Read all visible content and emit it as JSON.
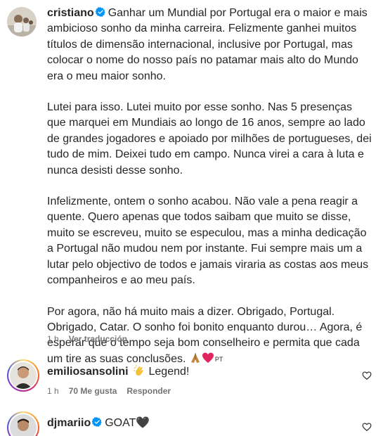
{
  "post": {
    "username": "cristiano",
    "paragraphs": [
      "Ganhar um Mundial por Portugal era o maior e mais ambicioso sonho da minha carreira. Felizmente ganhei muitos títulos de dimensão internacional, inclusive por Portugal, mas colocar o nome do nosso país no patamar mais alto do Mundo era o meu maior sonho.",
      "Lutei para isso. Lutei muito por esse sonho. Nas 5 presenças que marquei em Mundiais ao longo de 16 anos, sempre ao lado de grandes jogadores e apoiado por milhões de portugueses, dei tudo de mim. Deixei tudo em campo. Nunca virei a cara à luta e nunca desisti desse sonho.",
      "Infelizmente, ontem o sonho acabou. Não vale a pena reagir a quente. Quero apenas que todos saibam que muito se disse, muito se escreveu, muito se especulou, mas a minha dedicação a Portugal não mudou nem por instante. Fui sempre mais um a lutar pelo objectivo de todos e jamais viraria as costas aos meus companheiros e ao meu país.",
      "Por agora, não há muito mais a dizer. Obrigado, Portugal. Obrigado, Catar. O sonho foi bonito enquanto durou… Agora, é esperar que o tempo seja bom conselheiro e permita que cada um tire as suas conclusões."
    ],
    "flag_label": "PT",
    "time": "1 h",
    "translate_label": "Ver traducción"
  },
  "comments": [
    {
      "username": "emiliosansolini",
      "text": "Legend!",
      "time": "1 h",
      "likes": "70 Me gusta",
      "reply_label": "Responder"
    },
    {
      "username": "djmariio",
      "text": "GOAT🖤"
    }
  ],
  "colors": {
    "text": "#262626",
    "secondary": "#737373",
    "verified": "#0095f6",
    "heart_emoji": "#e0245e"
  }
}
